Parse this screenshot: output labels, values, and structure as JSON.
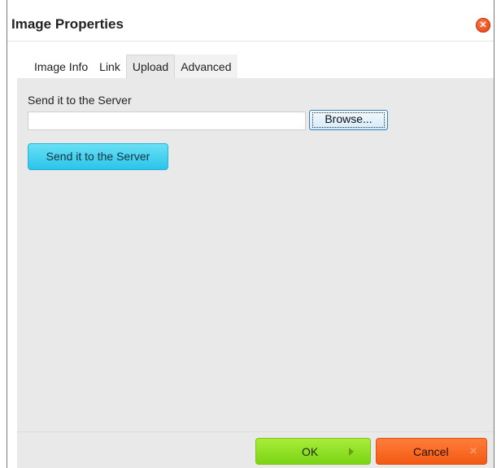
{
  "dialog": {
    "title": "Image Properties",
    "close_icon": "close-icon"
  },
  "tabs": [
    {
      "label": "Image Info",
      "active": false
    },
    {
      "label": "Link",
      "active": false
    },
    {
      "label": "Upload",
      "active": true
    },
    {
      "label": "Advanced",
      "active": false
    }
  ],
  "upload": {
    "field_label": "Send it to the Server",
    "file_value": "",
    "browse_label": "Browse...",
    "send_button_label": "Send it to the Server"
  },
  "footer": {
    "ok_label": "OK",
    "ok_icon": "arrow-right-icon",
    "cancel_label": "Cancel",
    "cancel_icon": "x-icon"
  },
  "colors": {
    "send_button": "#2bc4ea",
    "ok_button": "#7ad414",
    "cancel_button": "#f25a14"
  }
}
